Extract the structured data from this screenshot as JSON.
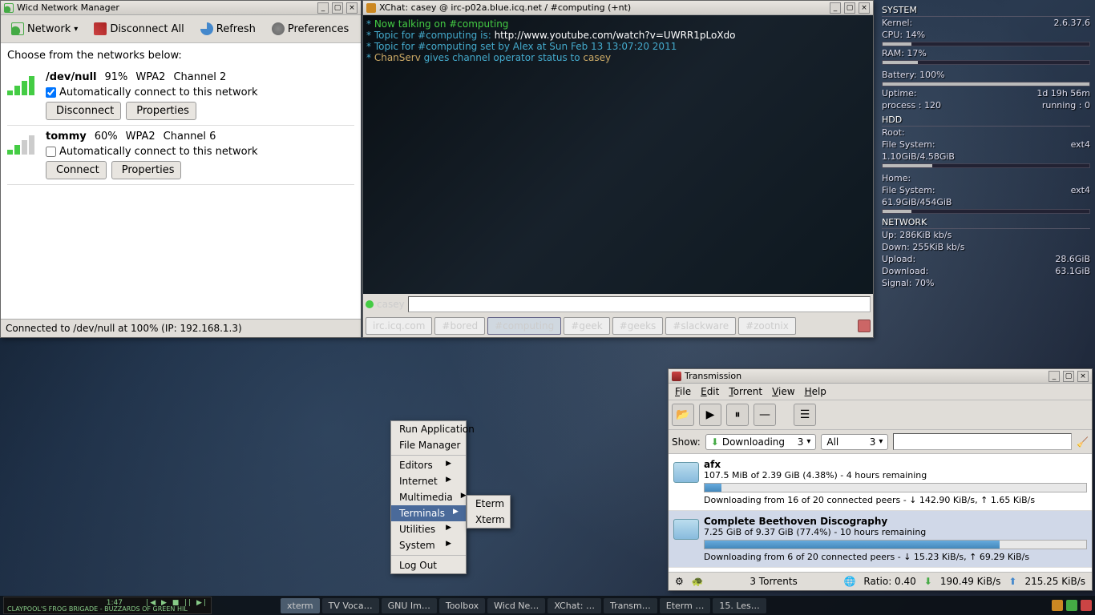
{
  "wicd": {
    "title": "Wicd Network Manager",
    "toolbar": {
      "network": "Network",
      "disconnect_all": "Disconnect All",
      "refresh": "Refresh",
      "preferences": "Preferences"
    },
    "prompt": "Choose from the networks below:",
    "networks": [
      {
        "ssid": "/dev/null",
        "signal": "91%",
        "security": "WPA2",
        "channel": "Channel 2",
        "auto_checked": true,
        "auto_label": "Automatically connect to this network",
        "btn1": "Disconnect",
        "btn2": "Properties",
        "strong": true
      },
      {
        "ssid": "tommy",
        "signal": "60%",
        "security": "WPA2",
        "channel": "Channel 6",
        "auto_checked": false,
        "auto_label": "Automatically connect to this network",
        "btn1": "Connect",
        "btn2": "Properties",
        "strong": false
      }
    ],
    "status": "Connected to /dev/null at 100% (IP: 192.168.1.3)"
  },
  "xchat": {
    "title": "XChat: casey @ irc-p02a.blue.icq.net / #computing (+nt)",
    "log": {
      "l1a": "* ",
      "l1b": "Now talking on #computing",
      "l2a": "* Topic for #computing is: ",
      "l2b": "http://www.youtube.com/watch?v=UWRR1pLoXdo",
      "l3": "* Topic for #computing set by Alex at Sun Feb 13 13:07:20 2011",
      "l4a": "* ",
      "l4b": "ChanServ",
      "l4c": " gives channel operator status to ",
      "l4d": "casey"
    },
    "nick": "casey",
    "tabs": [
      "irc.icq.com",
      "#bored",
      "#computing",
      "#geek",
      "#geeks",
      "#slackware",
      "#zootnix"
    ],
    "active_tab": 2
  },
  "conky": {
    "system_h": "SYSTEM",
    "kernel_l": "Kernel:",
    "kernel_v": "2.6.37.6",
    "cpu_l": "CPU: 14%",
    "ram_l": "RAM: 17%",
    "battery_l": "Battery: 100%",
    "uptime_l": "Uptime:",
    "uptime_v": "1d 19h 56m",
    "process_l": "process : 120",
    "running_l": "running : 0",
    "hdd_h": "HDD",
    "root_l": "Root:",
    "root_fs": "File System:",
    "root_fs_v": "ext4",
    "root_use": "1.10GiB/4.58GiB",
    "home_l": "Home:",
    "home_fs": "File System:",
    "home_fs_v": "ext4",
    "home_use": "61.9GiB/454GiB",
    "net_h": "NETWORK",
    "up_l": "Up: 286KiB kb/s",
    "down_l": "Down: 255KiB kb/s",
    "upload_l": "Upload:",
    "upload_v": "28.6GiB",
    "download_l": "Download:",
    "download_v": "63.1GiB",
    "signal_l": "Signal: 70%"
  },
  "transmission": {
    "title": "Transmission",
    "menu": {
      "file": "File",
      "edit": "Edit",
      "torrent": "Torrent",
      "view": "View",
      "help": "Help"
    },
    "filter": {
      "show": "Show:",
      "mode": "Downloading",
      "mode_n": "3",
      "all": "All",
      "all_n": "3"
    },
    "torrents": [
      {
        "name": "afx",
        "line1": "107.5 MiB of 2.39 GiB (4.38%) - 4 hours remaining",
        "line2": "Downloading from 16 of 20 connected peers - ↓ 142.90 KiB/s, ↑ 1.65 KiB/s",
        "pct": 4.38,
        "selected": false
      },
      {
        "name": "Complete Beethoven Discography",
        "line1": "7.25 GiB of 9.37 GiB (77.4%) - 10 hours remaining",
        "line2": "Downloading from 6 of 20 connected peers - ↓ 15.23 KiB/s, ↑ 69.29 KiB/s",
        "pct": 77.4,
        "selected": true
      }
    ],
    "status": {
      "torrents": "3 Torrents",
      "ratio": "Ratio: 0.40",
      "down": "190.49 KiB/s",
      "up": "215.25 KiB/s"
    }
  },
  "context_menu": {
    "items": [
      "Run Application",
      "File Manager",
      "Editors",
      "Internet",
      "Multimedia",
      "Terminals",
      "Utilities",
      "System",
      "Log Out"
    ],
    "submenu_parent": "Terminals",
    "submenu": [
      "Eterm",
      "Xterm"
    ]
  },
  "player": {
    "time": "1:47",
    "controls": "|◀ ▶ ■ || ▶|",
    "now_playing": "CLAYPOOL'S FROG BRIGADE - BUZZARDS OF GREEN HIL"
  },
  "taskbar": {
    "tasks": [
      "xterm",
      "TV Voca…",
      "GNU Im…",
      "Toolbox",
      "Wicd Ne…",
      "XChat: …",
      "Transm…",
      "Eterm …",
      "15. Les…"
    ]
  }
}
